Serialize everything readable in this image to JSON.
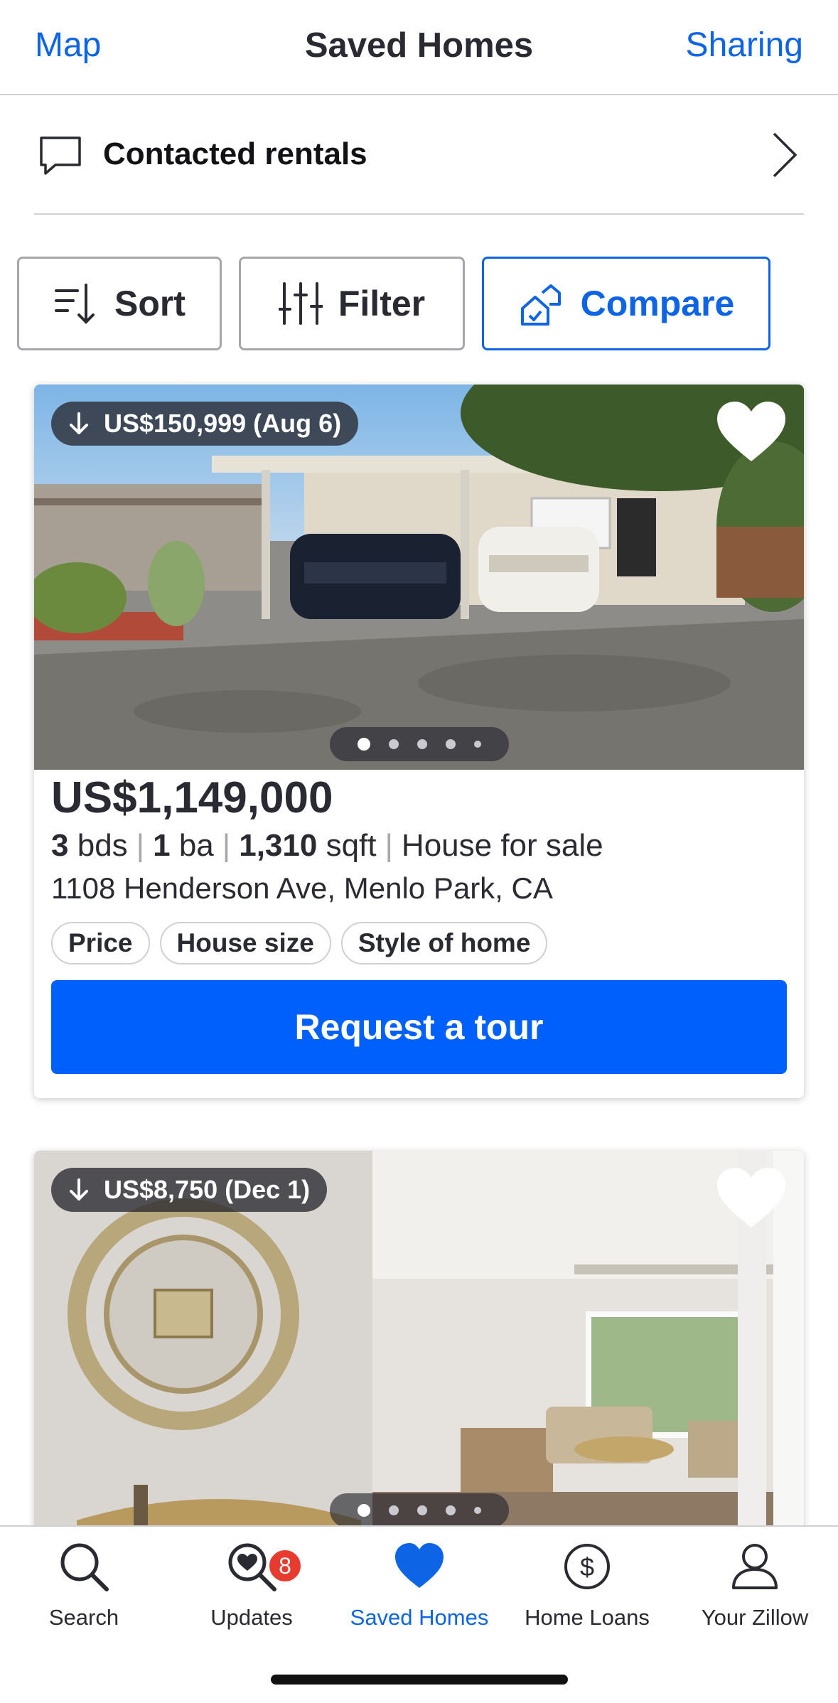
{
  "header": {
    "left_link": "Map",
    "title": "Saved Homes",
    "right_link": "Sharing"
  },
  "contacted": {
    "label": "Contacted rentals"
  },
  "toolbar": {
    "sort_label": "Sort",
    "filter_label": "Filter",
    "compare_label": "Compare"
  },
  "listings": [
    {
      "price_drop": "US$150,999 (Aug 6)",
      "price": "US$1,149,000",
      "beds": "3",
      "beds_unit": "bds",
      "baths": "1",
      "baths_unit": "ba",
      "sqft": "1,310",
      "sqft_unit": "sqft",
      "type": "House for sale",
      "address": "1108 Henderson Ave, Menlo Park, CA",
      "tags": [
        "Price",
        "House size",
        "Style of home"
      ],
      "cta": "Request a tour",
      "photo_index": 1,
      "photo_count": 5
    },
    {
      "price_drop": "US$8,750 (Dec 1)",
      "photo_index": 1,
      "photo_count": 5
    }
  ],
  "nav": {
    "items": [
      {
        "label": "Search",
        "icon": "search-icon"
      },
      {
        "label": "Updates",
        "icon": "updates-icon",
        "badge": "8"
      },
      {
        "label": "Saved Homes",
        "icon": "heart-icon",
        "active": true
      },
      {
        "label": "Home Loans",
        "icon": "dollar-icon"
      },
      {
        "label": "Your Zillow",
        "icon": "user-icon"
      }
    ]
  },
  "colors": {
    "accent": "#0d64e5",
    "cta": "#0060fb",
    "badge": "#e63b2e",
    "text": "#2a2a33"
  }
}
